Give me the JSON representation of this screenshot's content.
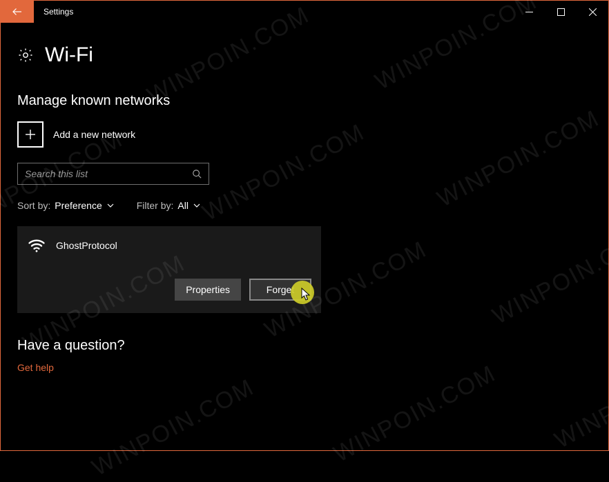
{
  "window": {
    "title": "Settings"
  },
  "page": {
    "title": "Wi-Fi",
    "section_heading": "Manage known networks"
  },
  "add_network": {
    "label": "Add a new network"
  },
  "search": {
    "placeholder": "Search this list"
  },
  "sort": {
    "label": "Sort by:",
    "value": "Preference"
  },
  "filter": {
    "label": "Filter by:",
    "value": "All"
  },
  "network": {
    "name": "GhostProtocol",
    "properties_label": "Properties",
    "forget_label": "Forget"
  },
  "help": {
    "heading": "Have a question?",
    "link_text": "Get help"
  },
  "watermark": {
    "text": "WINPOIN.COM"
  }
}
